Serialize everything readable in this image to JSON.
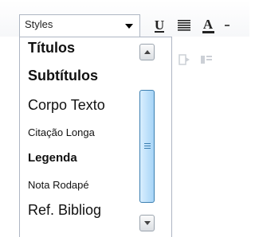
{
  "toolbar": {
    "styles_label": "Styles",
    "underline_glyph": "U",
    "text_color_glyph": "A",
    "icons": [
      "underline-icon",
      "justify-icon",
      "text-color-icon",
      "more-icon"
    ]
  },
  "style_list": {
    "items": [
      {
        "label": "Títulos"
      },
      {
        "label": "Subtítulos"
      },
      {
        "label": "Corpo Texto"
      },
      {
        "label": "Citação Longa"
      },
      {
        "label": "Legenda"
      },
      {
        "label": "Nota Rodapé"
      },
      {
        "label": "Ref. Bibliog"
      }
    ]
  },
  "colors": {
    "border": "#aeb6c3",
    "scroll_thumb": "#a7d4f6",
    "scroll_thumb_border": "#3c7fb1"
  }
}
